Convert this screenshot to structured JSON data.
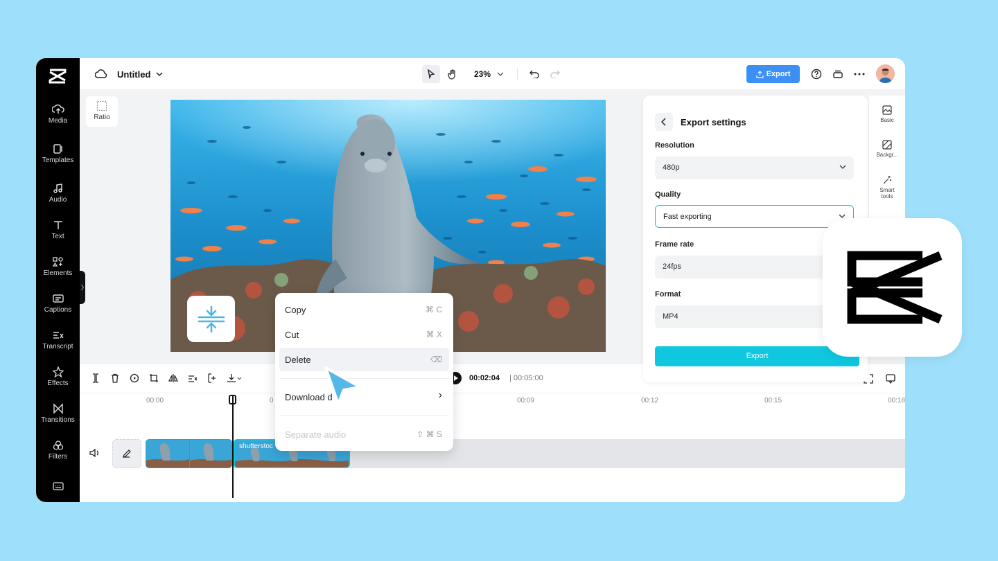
{
  "app": {
    "title": "Untitled",
    "zoom": "23%"
  },
  "header": {
    "export_label": "Export"
  },
  "sidebar": {
    "items": [
      {
        "label": "Media",
        "icon": "cloud-upload-icon"
      },
      {
        "label": "Templates",
        "icon": "templates-icon"
      },
      {
        "label": "Audio",
        "icon": "music-note-icon"
      },
      {
        "label": "Text",
        "icon": "text-icon"
      },
      {
        "label": "Elements",
        "icon": "elements-icon"
      },
      {
        "label": "Captions",
        "icon": "captions-icon"
      },
      {
        "label": "Transcript",
        "icon": "transcript-icon"
      },
      {
        "label": "Effects",
        "icon": "effects-icon"
      },
      {
        "label": "Transitions",
        "icon": "transitions-icon"
      },
      {
        "label": "Filters",
        "icon": "filters-icon"
      }
    ]
  },
  "canvas": {
    "ratio_label": "Ratio"
  },
  "export_panel": {
    "title": "Export settings",
    "resolution_label": "Resolution",
    "resolution_value": "480p",
    "quality_label": "Quality",
    "quality_value": "Fast exporting",
    "framerate_label": "Frame rate",
    "framerate_value": "24fps",
    "format_label": "Format",
    "format_value": "MP4",
    "export_button": "Export"
  },
  "right_rail": {
    "items": [
      {
        "label": "Basic"
      },
      {
        "label": "Backgr..."
      },
      {
        "label": "Smart tools"
      }
    ]
  },
  "context_menu": {
    "items": [
      {
        "label": "Copy",
        "shortcut": "⌘ C"
      },
      {
        "label": "Cut",
        "shortcut": "⌘ X"
      },
      {
        "label": "Delete",
        "shortcut": "⌫"
      },
      {
        "label": "Download d",
        "shortcut": "›"
      },
      {
        "label": "Separate audio",
        "shortcut": "⇧ ⌘ S"
      }
    ]
  },
  "timeline": {
    "current_time": "00:02:04",
    "total_time": "| 00:05:00",
    "ticks": [
      "00:00",
      "0",
      "00:09",
      "00:12",
      "00:15",
      "00:18"
    ],
    "clip_label": "shutterstoc"
  },
  "colors": {
    "accent": "#0fc8e0",
    "brand_export": "#3b8ff5",
    "backdrop": "#9ee0fb"
  }
}
